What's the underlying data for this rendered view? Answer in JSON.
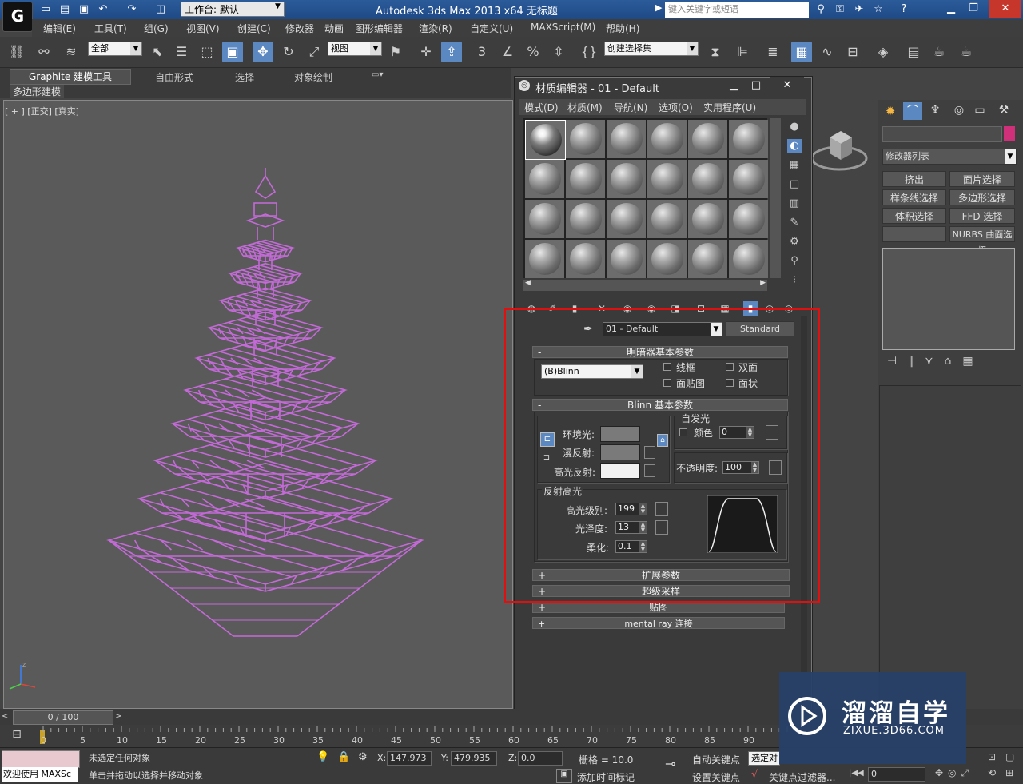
{
  "titlebar": {
    "logo": "G",
    "workspace_label": "工作台: 默认",
    "app_title": "Autodesk 3ds Max  2013 x64     无标题",
    "search_placeholder": "键入关键字或短语"
  },
  "menubar": [
    "编辑(E)",
    "工具(T)",
    "组(G)",
    "视图(V)",
    "创建(C)",
    "修改器",
    "动画",
    "图形编辑器",
    "渲染(R)",
    "自定义(U)",
    "MAXScript(M)",
    "帮助(H)"
  ],
  "toolbar": {
    "selection_filter": "全部",
    "ref_coord": "视图",
    "named_selection": "创建选择集",
    "snap_label": "3",
    "angle_label": "%"
  },
  "ribbon": {
    "tabs": [
      "Graphite 建模工具",
      "自由形式",
      "选择",
      "对象绘制"
    ],
    "panel_label": "多边形建模"
  },
  "viewport": {
    "label": "[ + ] [正交] [真实]",
    "object_color": "#c46ad8"
  },
  "command_panel": {
    "modifier_list": "修改器列表",
    "buttons": [
      "挤出",
      "面片选择",
      "样条线选择",
      "多边形选择",
      "体积选择",
      "FFD 选择",
      "NURBS 曲面选择"
    ],
    "color_swatch": "#d0307a"
  },
  "material_editor": {
    "title": "材质编辑器 - 01 - Default",
    "menus": [
      "模式(D)",
      "材质(M)",
      "导航(N)",
      "选项(O)",
      "实用程序(U)"
    ],
    "material_name": "01 - Default",
    "material_type": "Standard",
    "shader_rollout": "明暗器基本参数",
    "shader_type": "(B)Blinn",
    "checks": [
      "线框",
      "双面",
      "面贴图",
      "面状"
    ],
    "blinn_rollout": "Blinn 基本参数",
    "self_illum_group": "自发光",
    "color_label": "颜色",
    "self_illum_value": "0",
    "ambient": "环境光:",
    "diffuse": "漫反射:",
    "specular": "高光反射:",
    "opacity_label": "不透明度:",
    "opacity_value": "100",
    "spec_highlights": "反射高光",
    "spec_level_label": "高光级别:",
    "spec_level": "199",
    "gloss_label": "光泽度:",
    "gloss": "13",
    "soften_label": "柔化:",
    "soften": "0.1",
    "rollouts": [
      "扩展参数",
      "超级采样",
      "贴图",
      "mental ray 连接"
    ],
    "ambient_color": "#7a7a7a",
    "diffuse_color": "#7a7a7a",
    "specular_color": "#f2f2f2"
  },
  "timeline": {
    "frame": "0 / 100",
    "ticks": [
      "0",
      "5",
      "10",
      "15",
      "20",
      "25",
      "30",
      "35",
      "40",
      "45",
      "50",
      "55",
      "60",
      "65",
      "70",
      "75",
      "80",
      "85",
      "90"
    ]
  },
  "status": {
    "maxscript": "欢迎使用 MAXSc",
    "selection": "未选定任何对象",
    "prompt": "单击并拖动以选择并移动对象",
    "x_label": "X:",
    "x": "147.973",
    "y_label": "Y:",
    "y": "479.935",
    "z_label": "Z:",
    "z": "0.0",
    "grid": "栅格 = 10.0",
    "auto_key": "自动关键点",
    "set_key": "设置关键点",
    "selected": "选定对",
    "add_time_tag": "添加时间标记",
    "key_filter": "关键点过滤器...",
    "frame_field": "0"
  },
  "watermark": {
    "brand": "溜溜自学",
    "url": "ZIXUE.3D66.COM"
  }
}
